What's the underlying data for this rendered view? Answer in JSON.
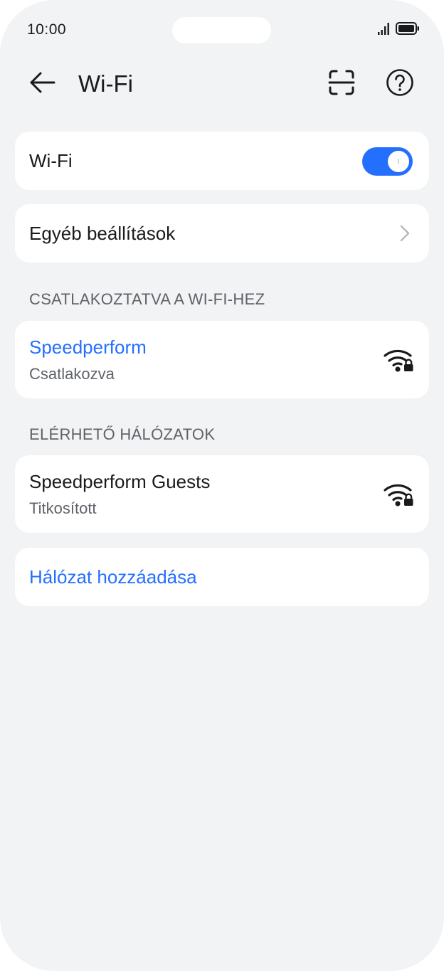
{
  "status_bar": {
    "time": "10:00",
    "signal_icon": "signal-bars-icon",
    "battery_icon": "battery-icon"
  },
  "app_bar": {
    "title": "Wi-Fi",
    "back_icon": "arrow-left-icon",
    "scan_icon": "scan-qr-icon",
    "help_icon": "help-circle-icon"
  },
  "wifi_toggle": {
    "label": "Wi-Fi",
    "state": "on"
  },
  "other_settings": {
    "label": "Egyéb beállítások",
    "icon": "chevron-right-icon"
  },
  "connected_section": {
    "header": "CSATLAKOZTATVA A WI-FI-HEZ",
    "network": {
      "name": "Speedperform",
      "status": "Csatlakozva",
      "icon": "wifi-lock-icon"
    }
  },
  "available_section": {
    "header": "ELÉRHETŐ HÁLÓZATOK",
    "networks": [
      {
        "name": "Speedperform Guests",
        "status": "Titkosított",
        "icon": "wifi-lock-icon"
      }
    ]
  },
  "add_network": {
    "label": "Hálózat hozzáadása"
  },
  "colors": {
    "accent": "#256fff",
    "background": "#f1f3f5",
    "card": "#ffffff",
    "secondary_text": "#5f6368"
  }
}
